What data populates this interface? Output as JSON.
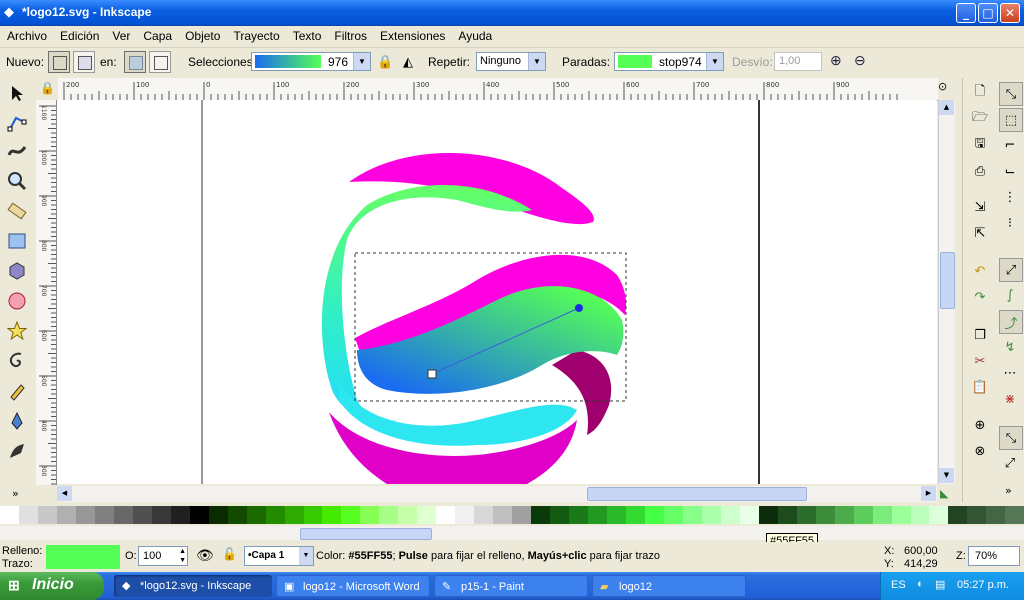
{
  "window": {
    "title": "*logo12.svg - Inkscape",
    "controls": {
      "minimize": "_",
      "maximize": "□",
      "close": "✕"
    }
  },
  "menu": [
    "Archivo",
    "Edición",
    "Ver",
    "Capa",
    "Objeto",
    "Trayecto",
    "Texto",
    "Filtros",
    "Extensiones",
    "Ayuda"
  ],
  "toolbar": {
    "nuevo_label": "Nuevo:",
    "en_label": "en:",
    "seleccion_label": "Selecciones:",
    "seleccion_value": "976",
    "repetir_label": "Repetir:",
    "repetir_value": "Ninguno",
    "paradas_label": "Paradas:",
    "paradas_value": "stop974",
    "paradas_color": "#55FF55",
    "desvio_label": "Desvío:",
    "desvio_value": "1,00"
  },
  "ruler": {
    "h_ticks": [
      "200",
      "100",
      "0",
      "100",
      "200",
      "300",
      "400",
      "500",
      "600",
      "700",
      "800",
      "900"
    ],
    "v_ticks": [
      "1100",
      "1000",
      "900",
      "800",
      "700",
      "600",
      "500",
      "400",
      "300"
    ]
  },
  "tooltip": "#55FF55",
  "status": {
    "relleno_label": "Relleno:",
    "trazo_label": "Trazo:",
    "fill_color": "#55FF55",
    "opacity_label": "O:",
    "opacity_value": "100",
    "layer": "•Capa 1",
    "message_prefix": "Color: ",
    "message_color": "#55FF55",
    "message_mid": "; ",
    "message_b1": "Pulse",
    "message_mid2": " para fijar el relleno, ",
    "message_b2": "Mayús+clic",
    "message_end": " para fijar trazo",
    "x_label": "X:",
    "x_value": "600,00",
    "y_label": "Y:",
    "y_value": "414,29",
    "zoom_label": "Z:",
    "zoom_value": "70%"
  },
  "taskbar": {
    "start": "Inicio",
    "tasks": [
      "*logo12.svg - Inkscape",
      "logo12 - Microsoft Word",
      "p15-1 - Paint",
      "logo12"
    ],
    "lang": "ES",
    "clock": "05:27 p.m."
  },
  "colors": {
    "magenta": "#ff00e0",
    "green": "#55ff55",
    "cyan": "#2ee6f0",
    "blue": "#1a6cf0",
    "xp_blue": "#0a5fe0"
  }
}
